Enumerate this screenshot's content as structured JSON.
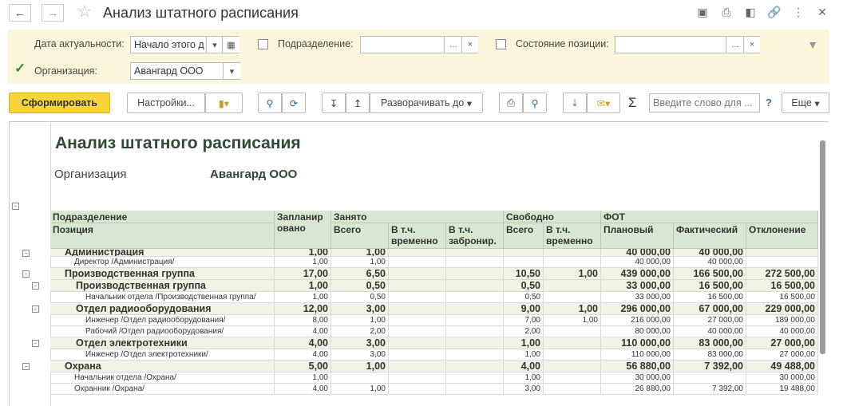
{
  "window": {
    "title": "Анализ штатного расписания",
    "back_icon": "arrow-left-icon",
    "forward_icon": "arrow-right-icon"
  },
  "filters": {
    "date_label": "Дата актуальности:",
    "date_value": "Начало этого д",
    "unit_label": "Подразделение:",
    "unit_value": "",
    "position_state_label": "Состояние позиции:",
    "position_state_value": "",
    "org_label": "Организация:",
    "org_value": "Авангард ООО",
    "org_checked": true,
    "unit_checked": false,
    "state_checked": false,
    "more_btn": "...",
    "clear_btn": "×"
  },
  "toolbar": {
    "generate": "Сформировать",
    "settings": "Настройки...",
    "expand_to": "Разворачивать до",
    "search_placeholder": "Введите слово для ...",
    "help": "?",
    "more": "Еще",
    "sum_symbol": "Σ"
  },
  "report": {
    "title": "Анализ штатного расписания",
    "org_label": "Организация",
    "org_value": "Авангард ООО",
    "headers": {
      "unit": "Подразделение",
      "position": "Позиция",
      "planned_1": "Запланир",
      "planned_2": "овано",
      "occupied": "Занято",
      "total": "Всего",
      "temp_1": "В т.ч.",
      "temp_2": "временно",
      "reserved_1": "В т.ч.",
      "reserved_2": "забронир.",
      "free": "Свободно",
      "free_total": "Всего",
      "free_temp_1": "В т.ч.",
      "free_temp_2": "временно",
      "payroll": "ФОТ",
      "planned": "Плановый",
      "actual": "Фактический",
      "deviation": "Отклонение"
    },
    "rows": [
      {
        "kind": "group",
        "level": 0,
        "name": "Администрация",
        "plan": "1,00",
        "occ": "1,00",
        "temp": "",
        "res": "",
        "free": "",
        "free_temp": "",
        "fot_plan": "40 000,00",
        "fot_fact": "40 000,00",
        "dev": ""
      },
      {
        "kind": "leaf",
        "level": 0,
        "name": "Директор /Администрация/",
        "plan": "1,00",
        "occ": "1,00",
        "temp": "",
        "res": "",
        "free": "",
        "free_temp": "",
        "fot_plan": "40 000,00",
        "fot_fact": "40 000,00",
        "dev": ""
      },
      {
        "kind": "group",
        "level": 0,
        "name": "Производственная группа",
        "plan": "17,00",
        "occ": "6,50",
        "temp": "",
        "res": "",
        "free": "10,50",
        "free_temp": "1,00",
        "fot_plan": "439 000,00",
        "fot_fact": "166 500,00",
        "dev": "272 500,00"
      },
      {
        "kind": "group",
        "level": 1,
        "name": "Производственная группа",
        "plan": "1,00",
        "occ": "0,50",
        "temp": "",
        "res": "",
        "free": "0,50",
        "free_temp": "",
        "fot_plan": "33 000,00",
        "fot_fact": "16 500,00",
        "dev": "16 500,00"
      },
      {
        "kind": "leaf",
        "level": 1,
        "name": "Начальник отдела /Производственная группа/",
        "plan": "1,00",
        "occ": "0,50",
        "temp": "",
        "res": "",
        "free": "0,50",
        "free_temp": "",
        "fot_plan": "33 000,00",
        "fot_fact": "16 500,00",
        "dev": "16 500,00"
      },
      {
        "kind": "group",
        "level": 1,
        "name": "Отдел радиооборудования",
        "plan": "12,00",
        "occ": "3,00",
        "temp": "",
        "res": "",
        "free": "9,00",
        "free_temp": "1,00",
        "fot_plan": "296 000,00",
        "fot_fact": "67 000,00",
        "dev": "229 000,00"
      },
      {
        "kind": "leaf",
        "level": 1,
        "name": "Инженер /Отдел радиооборудования/",
        "plan": "8,00",
        "occ": "1,00",
        "temp": "",
        "res": "",
        "free": "7,00",
        "free_temp": "1,00",
        "fot_plan": "216 000,00",
        "fot_fact": "27 000,00",
        "dev": "189 000,00"
      },
      {
        "kind": "leaf",
        "level": 1,
        "name": "Рабочий /Отдел радиооборудования/",
        "plan": "4,00",
        "occ": "2,00",
        "temp": "",
        "res": "",
        "free": "2,00",
        "free_temp": "",
        "fot_plan": "80 000,00",
        "fot_fact": "40 000,00",
        "dev": "40 000,00"
      },
      {
        "kind": "group",
        "level": 1,
        "name": "Отдел электротехники",
        "plan": "4,00",
        "occ": "3,00",
        "temp": "",
        "res": "",
        "free": "1,00",
        "free_temp": "",
        "fot_plan": "110 000,00",
        "fot_fact": "83 000,00",
        "dev": "27 000,00"
      },
      {
        "kind": "leaf",
        "level": 1,
        "name": "Инженер /Отдел электротехники/",
        "plan": "4,00",
        "occ": "3,00",
        "temp": "",
        "res": "",
        "free": "1,00",
        "free_temp": "",
        "fot_plan": "110 000,00",
        "fot_fact": "83 000,00",
        "dev": "27 000,00"
      },
      {
        "kind": "group",
        "level": 0,
        "name": "Охрана",
        "plan": "5,00",
        "occ": "1,00",
        "temp": "",
        "res": "",
        "free": "4,00",
        "free_temp": "",
        "fot_plan": "56 880,00",
        "fot_fact": "7 392,00",
        "dev": "49 488,00"
      },
      {
        "kind": "leaf",
        "level": 0,
        "name": "Начальник отдела /Охрана/",
        "plan": "1,00",
        "occ": "",
        "temp": "",
        "res": "",
        "free": "1,00",
        "free_temp": "",
        "fot_plan": "30 000,00",
        "fot_fact": "",
        "dev": "30 000,00"
      },
      {
        "kind": "leaf",
        "level": 0,
        "name": "Охранник /Охрана/",
        "plan": "4,00",
        "occ": "1,00",
        "temp": "",
        "res": "",
        "free": "3,00",
        "free_temp": "",
        "fot_plan": "26 880,00",
        "fot_fact": "7 392,00",
        "dev": "19 488,00"
      }
    ]
  }
}
